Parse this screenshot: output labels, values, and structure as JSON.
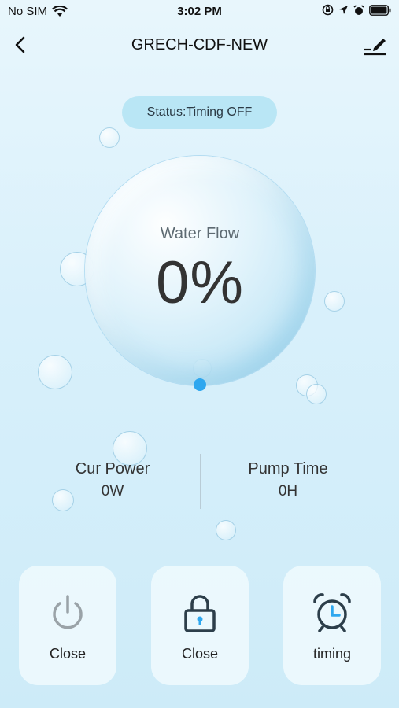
{
  "status_bar": {
    "carrier": "No SIM",
    "time": "3:02 PM"
  },
  "nav": {
    "title": "GRECH-CDF-NEW"
  },
  "status_pill": {
    "text": "Status:Timing OFF"
  },
  "water_flow": {
    "label": "Water Flow",
    "value": "0%"
  },
  "stats": {
    "cur_power": {
      "label": "Cur Power",
      "value": "0W"
    },
    "pump_time": {
      "label": "Pump Time",
      "value": "0H"
    }
  },
  "controls": [
    {
      "label": "Close",
      "icon": "power-icon"
    },
    {
      "label": "Close",
      "icon": "lock-icon"
    },
    {
      "label": "timing",
      "icon": "alarm-clock-icon"
    }
  ],
  "colors": {
    "accent": "#2ea7ef",
    "pill": "#b9e6f5",
    "icon_dark": "#2c3e4a",
    "icon_gray": "#9aa3a8"
  }
}
